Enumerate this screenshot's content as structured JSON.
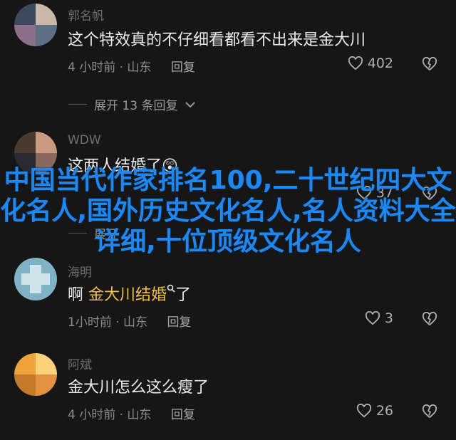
{
  "comments": [
    {
      "username": "郭名帆",
      "text": "这个特效真的不仔细看都看不出来是金大川",
      "time_location": "4 小时前 · 山东",
      "reply_label": "回复",
      "likes": "402",
      "avatar_colors": [
        "#3b4a5e",
        "#c9b7a8",
        "#8e6f8a",
        "#5c6f85"
      ]
    },
    {
      "username": "WDW",
      "text": "这两人结婚了",
      "emoji": "😲",
      "time_location": "",
      "reply_label": "",
      "likes": "37",
      "avatar_colors": [
        "#4a3a30",
        "#c99a80",
        "#2a2a33",
        "#8a6a60"
      ]
    },
    {
      "username": "海明",
      "text_prefix": "啊 ",
      "highlight": "金大川结婚",
      "text_suffix": "了",
      "time_location": "1小时前 · 山东",
      "reply_label": "回复",
      "likes": "3",
      "avatar_colors": [
        "#7fb2c4",
        "#cfe3ea",
        "#5b8fa5",
        "#a8cfd9"
      ]
    },
    {
      "username": "阿斌",
      "text": "金大川怎么这么瘦了",
      "time_location": "4 小时前 · 山东",
      "reply_label": "回复",
      "likes": "26",
      "avatar_colors": [
        "#f0a23a",
        "#ffd27a",
        "#c57a2a",
        "#e39040"
      ]
    }
  ],
  "expand_replies_label": "展开 13 条回复",
  "expand_replies_2_label": "展开",
  "overlay_title": "中国当代作家排名100,二十世纪四大文化名人,国外历史文化名人,名人资料大全详细,十位顶级文化名人",
  "colors": {
    "background": "#161616",
    "overlay": "#1e88f0",
    "highlight": "#f2c043"
  },
  "icons": {
    "like": "heart-outline-icon",
    "dislike": "broken-heart-icon",
    "expand": "chevron-down-icon",
    "search": "search-icon"
  }
}
